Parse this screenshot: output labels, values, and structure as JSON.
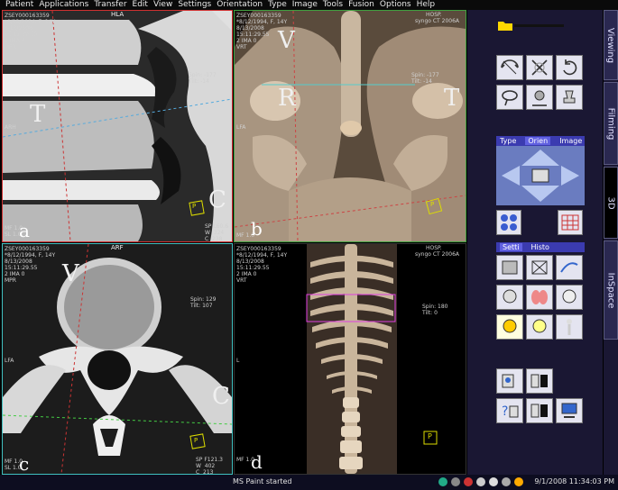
{
  "menu": [
    "Patient",
    "Applications",
    "Transfer",
    "Edit",
    "View",
    "Settings",
    "Orientation",
    "Type",
    "Image",
    "Tools",
    "Fusion",
    "Options",
    "Help"
  ],
  "viewports": {
    "a": {
      "orientation": "HLA",
      "info": "ZSEY000163359\n*8/12/1994, F, 14Y\n8/13/2008\n15:11:29.55\n2 IMA 0\nMPR",
      "spin": "Spin: -177\nTilt: -14",
      "side": "ARH",
      "bottom_left": "MF 1.0\nSL 1.0",
      "bottom_right": "SP L60.6\nW  324\nC  238",
      "letters": {
        "T": "T",
        "C": "C"
      },
      "panel": "a",
      "marker": "P"
    },
    "b": {
      "hosp": "HOSP.",
      "sub": "syngo CT 2006A",
      "info": "ZSEY000163359\n*8/12/1994, F, 14Y\n8/13/2008\n15:11:29.55\n2 IMA 0\nVRT",
      "spin": "Spin: -177\nTilt: -14",
      "side": "LFA",
      "bottom_left": "MF 1.0",
      "letters": {
        "V": "V",
        "R": "R",
        "T": "T"
      },
      "panel": "b",
      "marker": "P"
    },
    "c": {
      "orientation": "ARF",
      "info": "ZSEY000163359\n*8/12/1994, F, 14Y\n8/13/2008\n15:11:29.55\n2 IMA 0\nMPR",
      "spin": "Spin: 129\nTilt: 107",
      "side": "LFA",
      "bottom_left": "MF 1.0\nSL 1.0",
      "bottom_right": "SP F121.3\nW  402\nC  213",
      "letters": {
        "V": "V",
        "C": "C"
      },
      "panel": "c",
      "marker": "P"
    },
    "d": {
      "hosp": "HOSP.",
      "sub": "syngo CT 2006A",
      "info": "ZSEY000163359\n*8/12/1994, F, 14Y\n8/13/2008\n15:11:29.55\n2 IMA 0\nVRT",
      "spin": "Spin: 180\nTilt: 0",
      "side": "L",
      "bottom_left": "MF 1.0",
      "panel": "d",
      "marker": "P"
    }
  },
  "right_panel": {
    "orient_group": [
      "Type",
      "Orien",
      "Image"
    ],
    "settings_group": [
      "Setti",
      "Histo"
    ]
  },
  "tabs": [
    "Viewing",
    "Filming",
    "3D",
    "InSpace"
  ],
  "taskbar": {
    "status": "MS Paint started",
    "clock": "9/1/2008 11:34:03 PM"
  },
  "colors": {
    "menu_bg": "#0a0a0a",
    "panel_bg": "#1a1733",
    "group_header": "#3b3bb0",
    "viewport_a_border": "#d03030",
    "viewport_b_border": "#40a040",
    "viewport_c_border": "#40c0c0"
  }
}
